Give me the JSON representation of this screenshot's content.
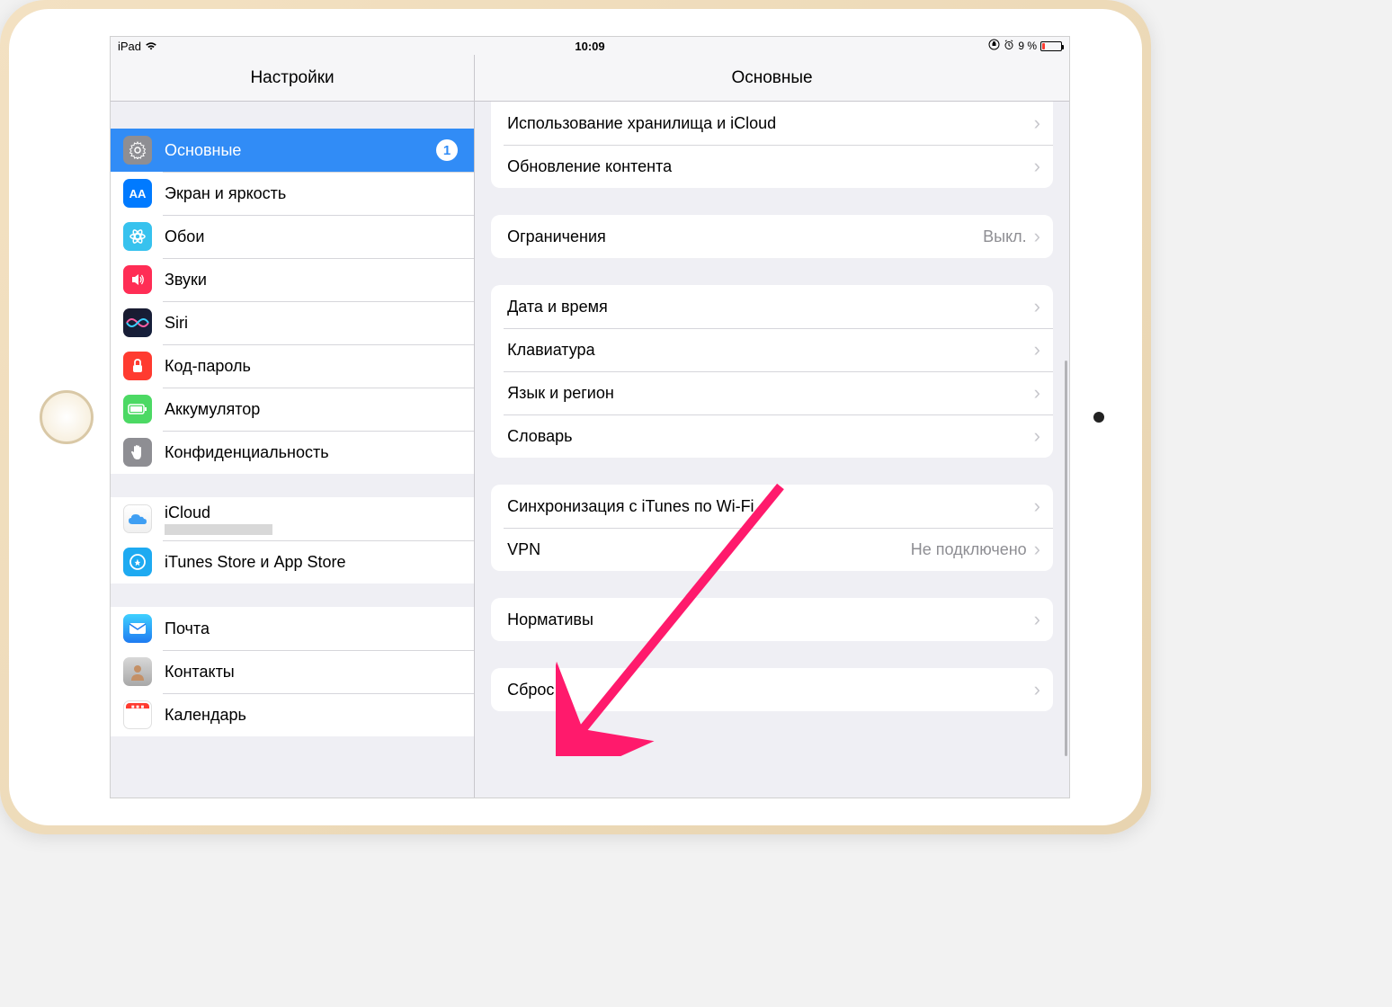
{
  "status": {
    "device": "iPad",
    "time": "10:09",
    "battery_pct": "9 %"
  },
  "sidebar": {
    "title": "Настройки",
    "items": [
      {
        "label": "Основные",
        "badge": "1",
        "icon": "gear",
        "color": "#8e8e93",
        "selected": true
      },
      {
        "label": "Экран и яркость",
        "icon": "aA",
        "color": "#007aff"
      },
      {
        "label": "Обои",
        "icon": "flower",
        "color": "#37c2ee"
      },
      {
        "label": "Звуки",
        "icon": "speaker",
        "color": "#ff2d55"
      },
      {
        "label": "Siri",
        "icon": "siri",
        "color": "#000"
      },
      {
        "label": "Код-пароль",
        "icon": "lock",
        "color": "#ff3b30"
      },
      {
        "label": "Аккумулятор",
        "icon": "battery",
        "color": "#4cd964"
      },
      {
        "label": "Конфиденциальность",
        "icon": "hand",
        "color": "#8e8e93"
      }
    ],
    "cloud_group": [
      {
        "label": "iCloud",
        "icon": "cloud",
        "color": "#fff",
        "has_sub": true
      },
      {
        "label": "iTunes Store и App Store",
        "icon": "appstore",
        "color": "#1eaaf1"
      }
    ],
    "apps_group": [
      {
        "label": "Почта",
        "icon": "mail",
        "color": "#1eaaf1"
      },
      {
        "label": "Контакты",
        "icon": "contacts",
        "color": "#8e8e93"
      },
      {
        "label": "Календарь",
        "icon": "calendar",
        "color": "#fff"
      }
    ]
  },
  "detail": {
    "title": "Основные",
    "group1": [
      {
        "label": "Использование хранилища и iCloud"
      },
      {
        "label": "Обновление контента"
      }
    ],
    "group2": [
      {
        "label": "Ограничения",
        "value": "Выкл."
      }
    ],
    "group3": [
      {
        "label": "Дата и время"
      },
      {
        "label": "Клавиатура"
      },
      {
        "label": "Язык и регион"
      },
      {
        "label": "Словарь"
      }
    ],
    "group4": [
      {
        "label": "Синхронизация с iTunes по Wi-Fi"
      },
      {
        "label": "VPN",
        "value": "Не подключено"
      }
    ],
    "group5": [
      {
        "label": "Нормативы"
      }
    ],
    "group6": [
      {
        "label": "Сброс"
      }
    ]
  }
}
